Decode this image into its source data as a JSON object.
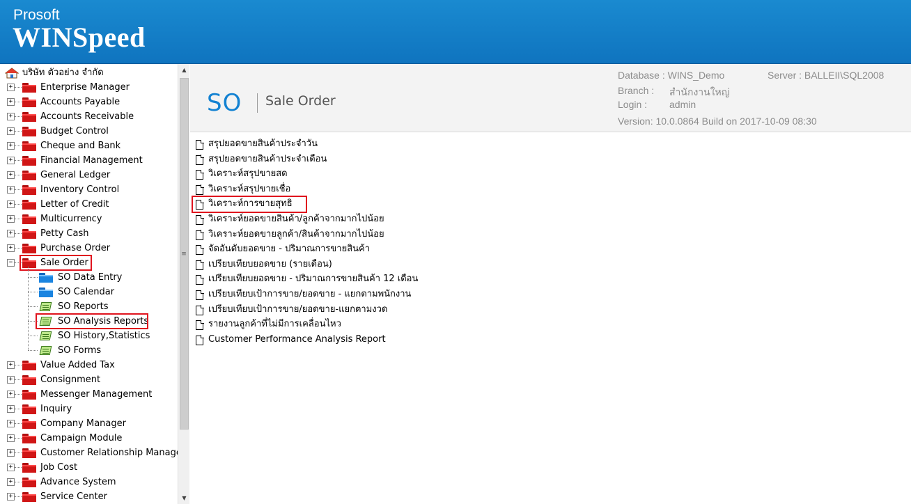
{
  "app": {
    "brand_small": "Prosoft",
    "brand_big": "WINSpeed"
  },
  "tree": {
    "root": "บริษัท ตัวอย่าง จำกัด",
    "items": [
      {
        "label": "Enterprise Manager",
        "expander": "+"
      },
      {
        "label": "Accounts Payable",
        "expander": "+"
      },
      {
        "label": "Accounts Receivable",
        "expander": "+"
      },
      {
        "label": "Budget Control",
        "expander": "+"
      },
      {
        "label": "Cheque and Bank",
        "expander": "+"
      },
      {
        "label": "Financial Management",
        "expander": "+"
      },
      {
        "label": "General Ledger",
        "expander": "+"
      },
      {
        "label": "Inventory Control",
        "expander": "+"
      },
      {
        "label": "Letter of Credit",
        "expander": "+"
      },
      {
        "label": "Multicurrency",
        "expander": "+"
      },
      {
        "label": "Petty Cash",
        "expander": "+"
      },
      {
        "label": "Purchase Order",
        "expander": "+"
      },
      {
        "label": "Sale Order",
        "expander": "−",
        "selected_box": true
      },
      {
        "label": "SO Data Entry",
        "child": true,
        "icon": "blue-folder-icon"
      },
      {
        "label": "SO Calendar",
        "child": true,
        "icon": "blue-folder-icon"
      },
      {
        "label": "SO Reports",
        "child": true,
        "icon": "report-icon"
      },
      {
        "label": "SO Analysis Reports",
        "child": true,
        "icon": "report-icon",
        "selected_box": true
      },
      {
        "label": "SO History,Statistics",
        "child": true,
        "icon": "report-icon"
      },
      {
        "label": "SO Forms",
        "child": true,
        "icon": "report-icon"
      },
      {
        "label": "Value Added Tax",
        "expander": "+"
      },
      {
        "label": "Consignment",
        "expander": "+"
      },
      {
        "label": "Messenger Management",
        "expander": "+"
      },
      {
        "label": "Inquiry",
        "expander": "+"
      },
      {
        "label": "Company Manager",
        "expander": "+"
      },
      {
        "label": "Campaign Module",
        "expander": "+"
      },
      {
        "label": "Customer Relationship Manage",
        "expander": "+"
      },
      {
        "label": "Job Cost",
        "expander": "+"
      },
      {
        "label": "Advance System",
        "expander": "+"
      },
      {
        "label": "Service Center",
        "expander": "+"
      }
    ]
  },
  "module": {
    "code": "SO",
    "name": "Sale Order"
  },
  "info": {
    "database_label": "Database : WINS_Demo",
    "server_label": "Server : BALLEII\\SQL2008",
    "branch_label": "Branch :",
    "branch_value": "สำนักงานใหญ่",
    "login_label": "Login :",
    "login_value": "admin",
    "version": "Version: 10.0.0864  Build on 2017-10-09 08:30"
  },
  "reports": [
    {
      "label": "สรุปยอดขายสินค้าประจำวัน"
    },
    {
      "label": "สรุปยอดขายสินค้าประจำเดือน"
    },
    {
      "label": "วิเคราะห์สรุปขายสด"
    },
    {
      "label": "วิเคราะห์สรุปขายเชื่อ"
    },
    {
      "label": "วิเคราะห์การขายสุทธิ",
      "selected_box": true
    },
    {
      "label": "วิเคราะห์ยอดขายสินค้า/ลูกค้าจากมากไปน้อย"
    },
    {
      "label": "วิเคราะห์ยอดขายลูกค้า/สินค้าจากมากไปน้อย"
    },
    {
      "label": "จัดอันดับยอดขาย - ปริมาณการขายสินค้า"
    },
    {
      "label": "เปรียบเทียบยอดขาย (รายเดือน)"
    },
    {
      "label": "เปรียบเทียบยอดขาย - ปริมาณการขายสินค้า  12 เดือน"
    },
    {
      "label": "เปรียบเทียบเป้าการขาย/ยอดขาย - แยกตามพนักงาน"
    },
    {
      "label": "เปรียบเทียบเป้าการขาย/ยอดขาย-แยกตามงวด"
    },
    {
      "label": "รายงานลูกค้าที่ไม่มีการเคลื่อนไหว"
    },
    {
      "label": "Customer Performance Analysis Report"
    }
  ],
  "colors": {
    "banner": "#1382d2",
    "highlight": "#e0141e",
    "module_code": "#1382d2"
  }
}
